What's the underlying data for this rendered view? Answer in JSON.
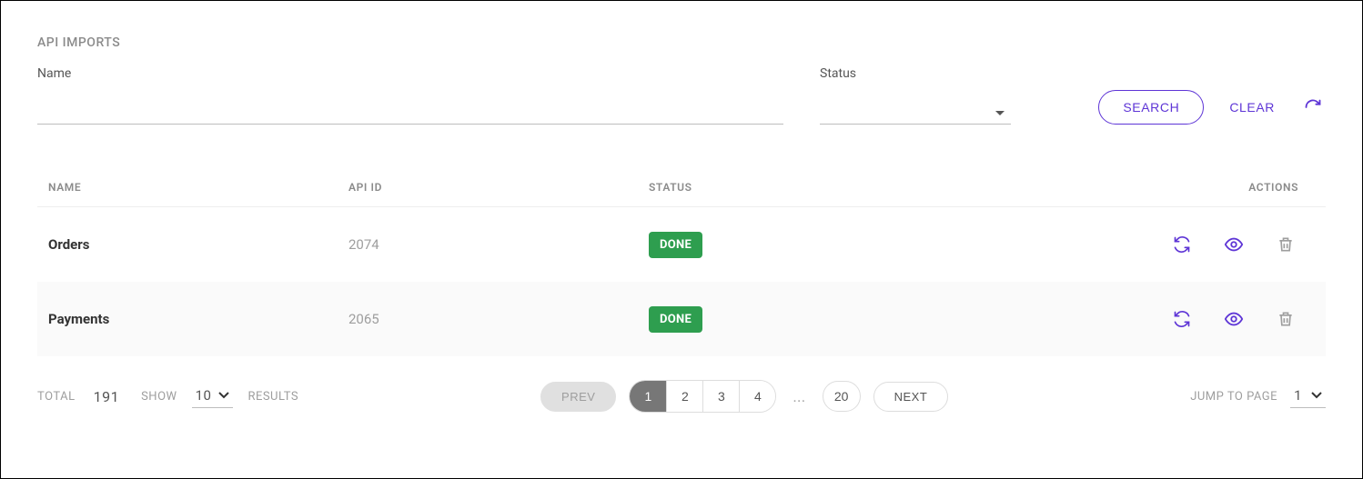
{
  "section_title": "API IMPORTS",
  "filters": {
    "name_label": "Name",
    "name_value": "",
    "status_label": "Status",
    "status_value": "",
    "search_label": "SEARCH",
    "clear_label": "CLEAR"
  },
  "table": {
    "headers": {
      "name": "NAME",
      "api_id": "API ID",
      "status": "STATUS",
      "actions": "ACTIONS"
    },
    "rows": [
      {
        "name": "Orders",
        "api_id": "2074",
        "status": "DONE"
      },
      {
        "name": "Payments",
        "api_id": "2065",
        "status": "DONE"
      }
    ]
  },
  "footer": {
    "total_label": "TOTAL",
    "total_value": "191",
    "show_label": "SHOW",
    "show_value": "10",
    "results_label": "RESULTS",
    "prev_label": "PREV",
    "next_label": "NEXT",
    "pages_first_group": [
      "1",
      "2",
      "3",
      "4"
    ],
    "active_page": "1",
    "ellipsis": "...",
    "last_page": "20",
    "jump_label": "JUMP TO PAGE",
    "jump_value": "1"
  },
  "colors": {
    "primary": "#5e35d6",
    "badge": "#2e9e4f"
  }
}
